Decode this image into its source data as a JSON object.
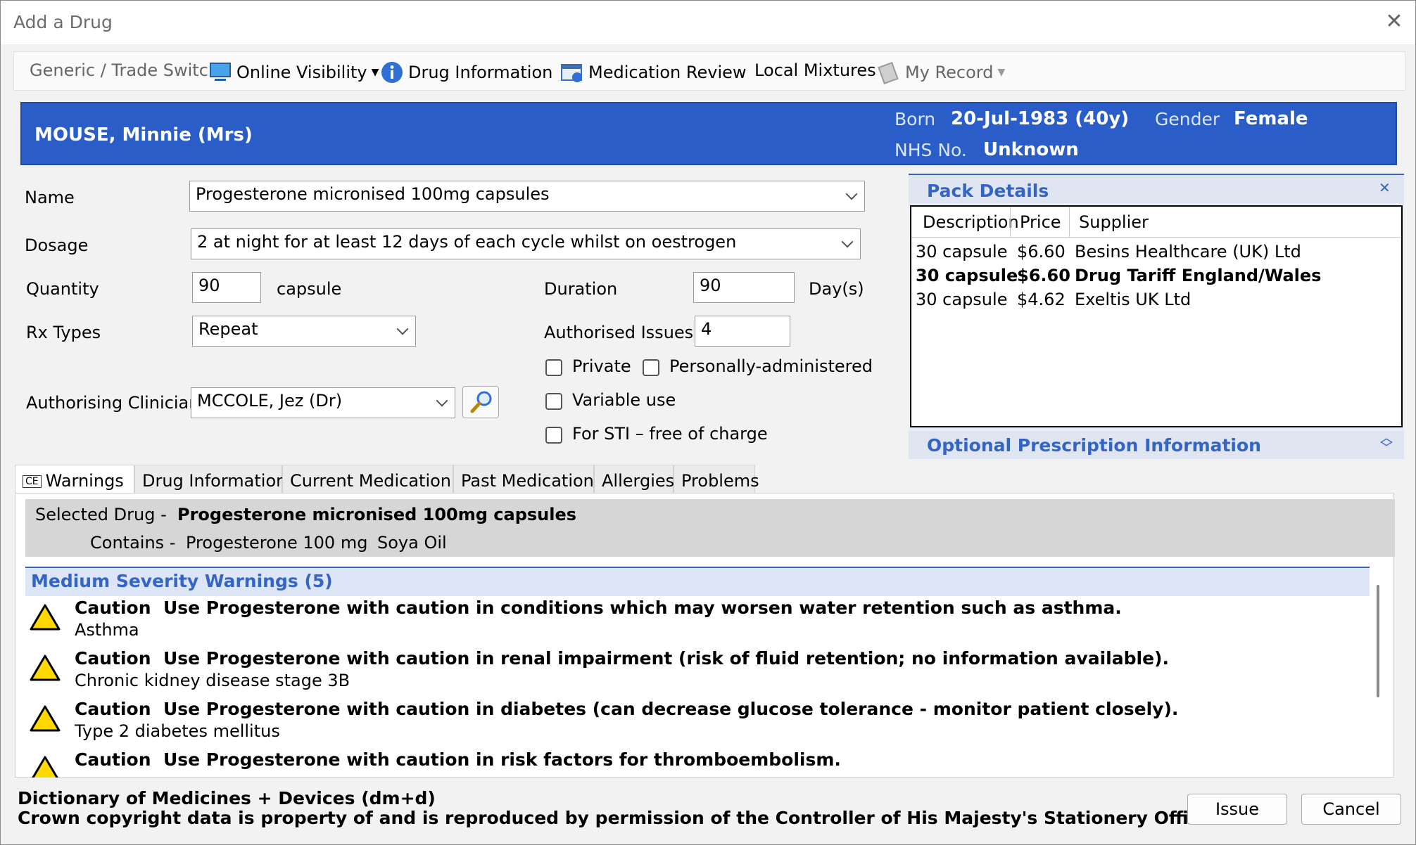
{
  "window": {
    "title": "Add a Drug"
  },
  "toolbar": {
    "generic_trade": "Generic / Trade Switch",
    "online_visibility": "Online Visibility",
    "drug_information": "Drug Information",
    "medication_review": "Medication Review",
    "local_mixtures": "Local Mixtures",
    "my_record": "My Record"
  },
  "patient": {
    "name": "MOUSE, Minnie (Mrs)",
    "born_label": "Born",
    "born_value": "20-Jul-1983 (40y)",
    "gender_label": "Gender",
    "gender_value": "Female",
    "nhs_label": "NHS No.",
    "nhs_value": "Unknown"
  },
  "form": {
    "name_label": "Name",
    "name_value": "Progesterone micronised 100mg capsules",
    "dosage_label": "Dosage",
    "dosage_value": "2 at night for at least 12 days of each cycle whilst on oestrogen",
    "quantity_label": "Quantity",
    "quantity_value": "90",
    "quantity_unit": "capsule",
    "duration_label": "Duration",
    "duration_value": "90",
    "duration_unit": "Day(s)",
    "rx_label": "Rx Types",
    "rx_value": "Repeat",
    "auth_issues_label": "Authorised Issues",
    "auth_issues_value": "4",
    "private_label": "Private",
    "personally_label": "Personally-administered",
    "variable_label": "Variable use",
    "sti_label": "For STI – free of charge",
    "clinician_label": "Authorising Clinician",
    "clinician_value": "MCCOLE, Jez (Dr)"
  },
  "pack": {
    "title": "Pack Details",
    "headers": [
      "Description",
      "Price",
      "Supplier"
    ],
    "rows": [
      {
        "desc": "30 capsule",
        "price": "$6.60",
        "supplier": "Besins Healthcare (UK) Ltd"
      },
      {
        "desc": "30 capsule",
        "price": "$6.60",
        "supplier": "Drug Tariff England/Wales"
      },
      {
        "desc": "30 capsule",
        "price": "$4.62",
        "supplier": "Exeltis UK Ltd"
      }
    ],
    "optional_title": "Optional Prescription Information"
  },
  "tabs": [
    "Warnings",
    "Drug Information",
    "Current Medication",
    "Past Medication",
    "Allergies",
    "Problems"
  ],
  "warnings": {
    "selected_label": "Selected Drug -",
    "selected_value": "Progesterone micronised 100mg capsules",
    "contains_label": "Contains -",
    "contains_1": "Progesterone 100 mg",
    "contains_2": "Soya Oil",
    "severity_header": "Medium Severity Warnings (5)",
    "items": [
      {
        "title": "Caution",
        "text": "Use Progesterone with caution in conditions which may worsen water retention such as asthma.",
        "sub": "Asthma"
      },
      {
        "title": "Caution",
        "text": "Use Progesterone with caution in renal impairment (risk of fluid retention; no information available).",
        "sub": "Chronic kidney disease stage 3B"
      },
      {
        "title": "Caution",
        "text": "Use Progesterone with caution in diabetes (can decrease glucose tolerance - monitor patient closely).",
        "sub": "Type 2 diabetes mellitus"
      },
      {
        "title": "Caution",
        "text": "Use Progesterone with caution in risk factors for thromboembolism.",
        "sub": ""
      }
    ]
  },
  "footer": {
    "line1": "Dictionary of Medicines + Devices (dm+d)",
    "line2": "Crown copyright data is property of and is reproduced by permission of the Controller of His Majesty's Stationery Office",
    "issue": "Issue",
    "cancel": "Cancel"
  }
}
